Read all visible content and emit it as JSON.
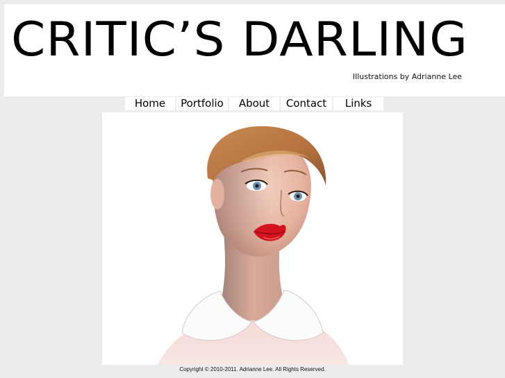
{
  "header": {
    "site_title": "CRITIC’S DARLING",
    "tagline": "Illustrations by Adrianne Lee"
  },
  "nav": {
    "items": [
      {
        "label": "Home"
      },
      {
        "label": "Portfolio"
      },
      {
        "label": "About"
      },
      {
        "label": "Contact"
      },
      {
        "label": "Links"
      }
    ]
  },
  "artwork": {
    "subject": "portrait illustration of a woman with short auburn hair, blue eyes, red lips and a white peter pan collar"
  },
  "footer": {
    "copyright": "Copyright © 2010-2011. Adrianne Lee. All Rights Reserved."
  }
}
